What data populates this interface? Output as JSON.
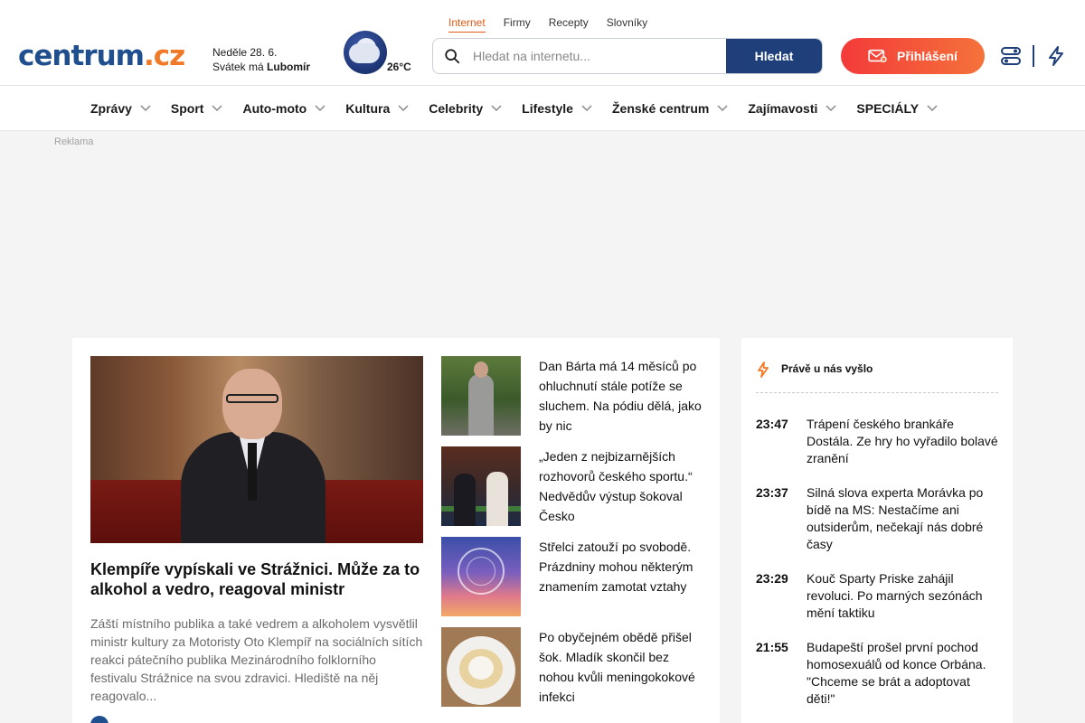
{
  "header": {
    "logo_part1": "centrum",
    "logo_part2": ".cz",
    "date": "Neděle 28. 6.",
    "nameday_prefix": "Svátek má",
    "nameday_name": "Lubomír",
    "temperature": "26°C",
    "weather_icon": "cloud-icon",
    "top_links": [
      "Internet",
      "Firmy",
      "Recepty",
      "Slovníky"
    ],
    "active_top_link": "Internet",
    "search": {
      "placeholder": "Hledat na internetu...",
      "value": "",
      "button_label": "Hledat"
    },
    "login_label": "Přihlášení",
    "brand_colors": {
      "blue": "#1f4f8f",
      "orange": "#f07a28",
      "login_red": "#f33a3a"
    }
  },
  "categories": [
    "Zprávy",
    "Sport",
    "Auto-moto",
    "Kultura",
    "Celebrity",
    "Lifestyle",
    "Ženské centrum",
    "Zajímavosti",
    "SPECIÁLY"
  ],
  "ad_label": "Reklama",
  "main": {
    "hero": {
      "title": "Klempíře vypískali ve Strážnici. Může za to alkohol a vedro, reagoval ministr",
      "perex": "Záští místního publika a také vedrem a alkoholem vysvětlil ministr kultury za Motoristy Oto Klempíř na sociálních sítích reakci pátečního publika Mezinárodního folklorního festivalu Strážnice na svou zdravici. Hlediště na něj reagovalo..."
    },
    "side_articles": [
      {
        "title": "Dan Bárta má 14 měsíců po ohluchnutí stále potíže se sluchem. Na pódiu dělá, jako by nic"
      },
      {
        "title": "„Jeden z nejbizarnějších rozhovorů českého sportu.“ Nedvědův výstup šokoval Česko"
      },
      {
        "title": "Střelci zatouží po svobodě. Prázdniny mohou některým znamením zamotat vztahy"
      },
      {
        "title": "Po obyčejném obědě přišel šok. Mladík skončil bez nohou kvůli meningokokové infekci"
      }
    ]
  },
  "feed": {
    "heading": "Právě u nás vyšlo",
    "items": [
      {
        "time": "23:47",
        "text": "Trápení českého brankáře Dostála. Ze hry ho vyřadilo bolavé zranění"
      },
      {
        "time": "23:37",
        "text": "Silná slova experta Morávka po bídě na MS: Nestačíme ani outsiderům, nečekají nás dobré časy"
      },
      {
        "time": "23:29",
        "text": "Kouč Sparty Priske zahájil revoluci. Po marných sezónách mění taktiku"
      },
      {
        "time": "21:55",
        "text": "Budapeští prošel první pochod homosexuálů od konce Orbána. \"Chceme se brát a adoptovat děti!\""
      }
    ]
  }
}
